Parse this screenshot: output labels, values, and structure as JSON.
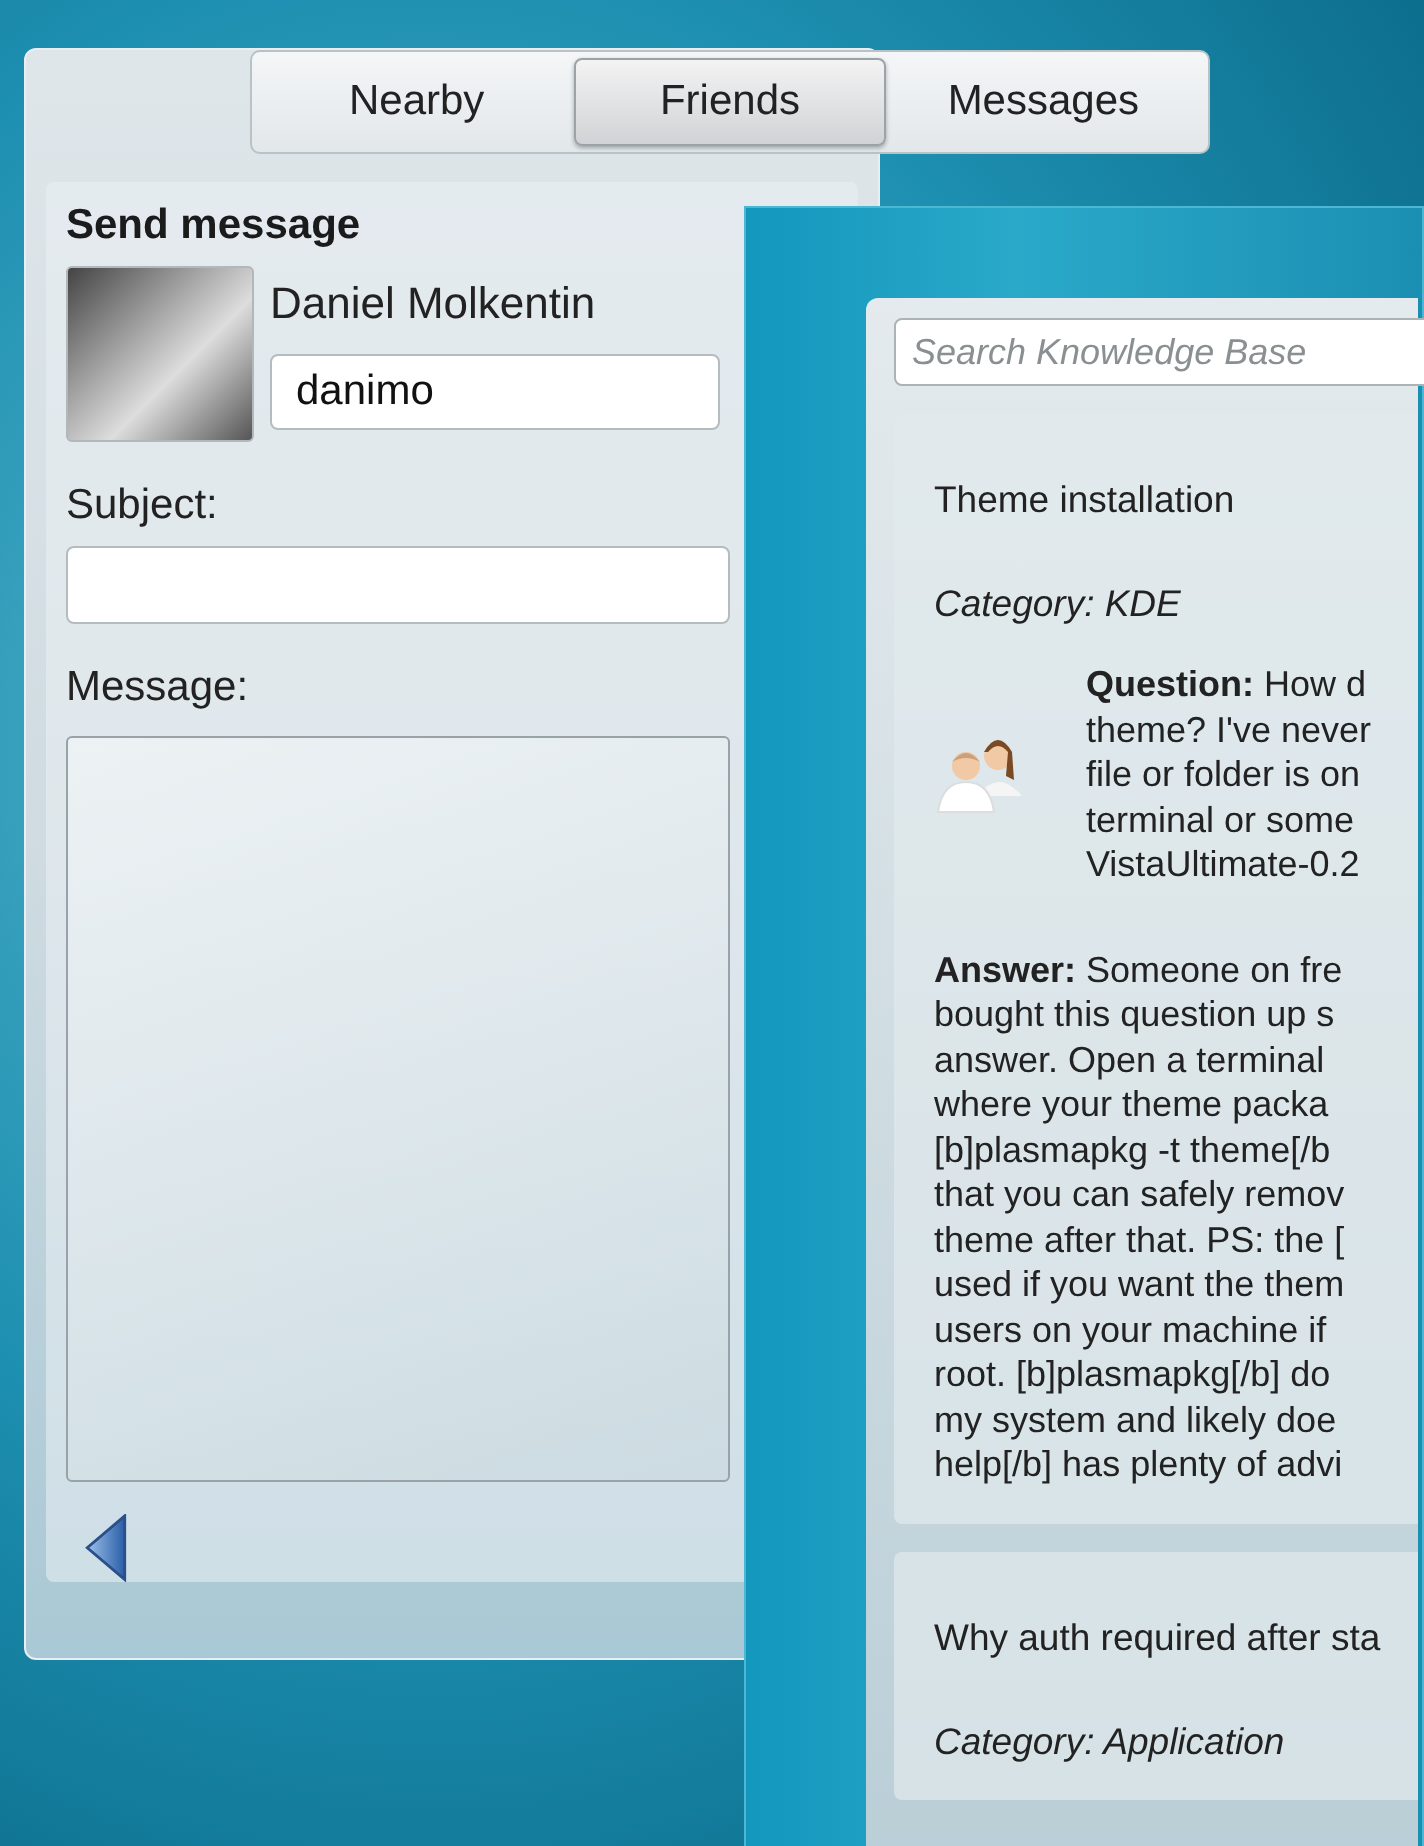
{
  "tabs": [
    {
      "label": "Nearby",
      "selected": false
    },
    {
      "label": "Friends",
      "selected": true
    },
    {
      "label": "Messages",
      "selected": false
    }
  ],
  "send_message": {
    "title": "Send message",
    "contact_name": "Daniel Molkentin",
    "username": "danimo",
    "subject_label": "Subject:",
    "message_label": "Message:"
  },
  "knowledge_base": {
    "search": {
      "placeholder": "Search Knowledge Base"
    },
    "items": [
      {
        "title": "Theme installation",
        "category": "Category: KDE",
        "question_lines": [
          "**Question:** How d",
          "theme? I've never",
          "file or folder is on",
          "terminal or some",
          "VistaUltimate-0.2"
        ],
        "answer_lines": [
          "**Answer:** Someone on fre",
          "bought this question up s",
          "answer. Open a terminal",
          "where your theme packa",
          "[b]plasmapkg -t theme[/b",
          "that you can safely remov",
          "theme after that. PS: the [",
          "used if you want the them",
          "users on your machine if",
          "root. [b]plasmapkg[/b] do",
          "my system and likely doe",
          "help[/b] has plenty of advi"
        ]
      },
      {
        "title": "Why auth required after sta",
        "category": "Category: Application"
      }
    ]
  }
}
